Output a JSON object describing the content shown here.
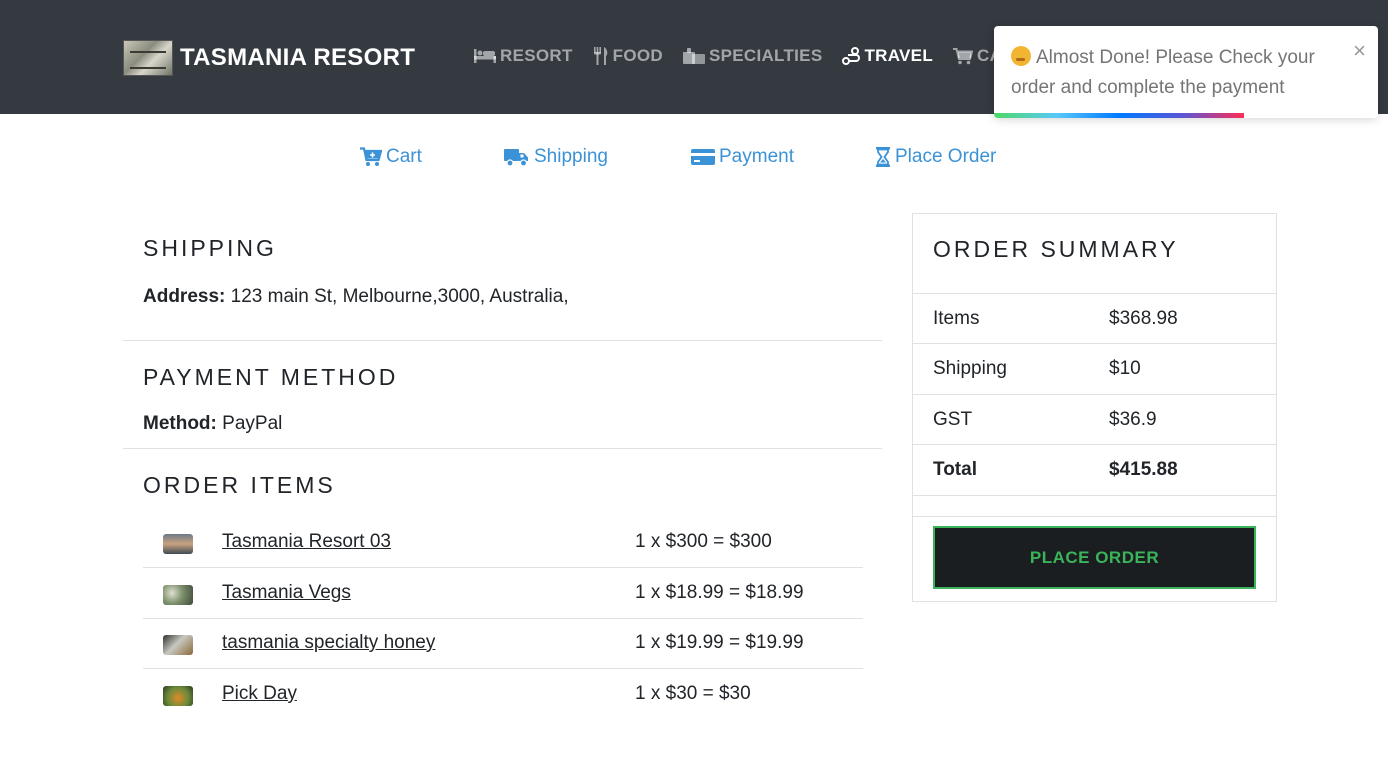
{
  "brand": {
    "name": "TASMANIA RESORT",
    "logo": "resort-logo"
  },
  "nav": {
    "items": [
      {
        "label": "RESORT",
        "icon": "bed-icon",
        "active": false
      },
      {
        "label": "FOOD",
        "icon": "utensils-icon",
        "active": false
      },
      {
        "label": "SPECIALTIES",
        "icon": "gift-icon",
        "active": false
      },
      {
        "label": "TRAVEL",
        "icon": "route-icon",
        "active": true
      },
      {
        "label": "CAR",
        "icon": "cart-icon",
        "active": false
      }
    ]
  },
  "toast": {
    "emoji": "party-face-emoji",
    "message": "Almost Done! Please Check your order and complete the payment",
    "close": "×",
    "progress": 0.65
  },
  "steps": [
    {
      "label": "Cart",
      "icon": "cart-icon"
    },
    {
      "label": "Shipping",
      "icon": "truck-icon"
    },
    {
      "label": "Payment",
      "icon": "credit-card-icon"
    },
    {
      "label": "Place Order",
      "icon": "hourglass-icon"
    }
  ],
  "shipping": {
    "title": "SHIPPING",
    "address_label": "Address:",
    "address": "123 main St, Melbourne,3000, Australia,"
  },
  "payment": {
    "title": "PAYMENT METHOD",
    "method_label": "Method:",
    "method": "PayPal"
  },
  "order_items": {
    "title": "ORDER ITEMS",
    "items": [
      {
        "name": "Tasmania Resort 03",
        "price": "1 x $300 = $300"
      },
      {
        "name": "Tasmania Vegs",
        "price": "1 x $18.99 = $18.99"
      },
      {
        "name": "tasmania specialty honey",
        "price": "1 x $19.99 = $19.99"
      },
      {
        "name": "Pick Day",
        "price": "1 x $30 = $30"
      }
    ]
  },
  "summary": {
    "title": "ORDER SUMMARY",
    "rows": [
      {
        "label": "Items",
        "value": "$368.98"
      },
      {
        "label": "Shipping",
        "value": "$10"
      },
      {
        "label": "GST",
        "value": "$36.9"
      },
      {
        "label": "Total",
        "value": "$415.88"
      }
    ],
    "button": "PLACE ORDER"
  },
  "colors": {
    "navbar": "#343a40",
    "link": "#3b92d6",
    "button_bg": "#1b1e20",
    "button_accent": "#3ab35a"
  }
}
